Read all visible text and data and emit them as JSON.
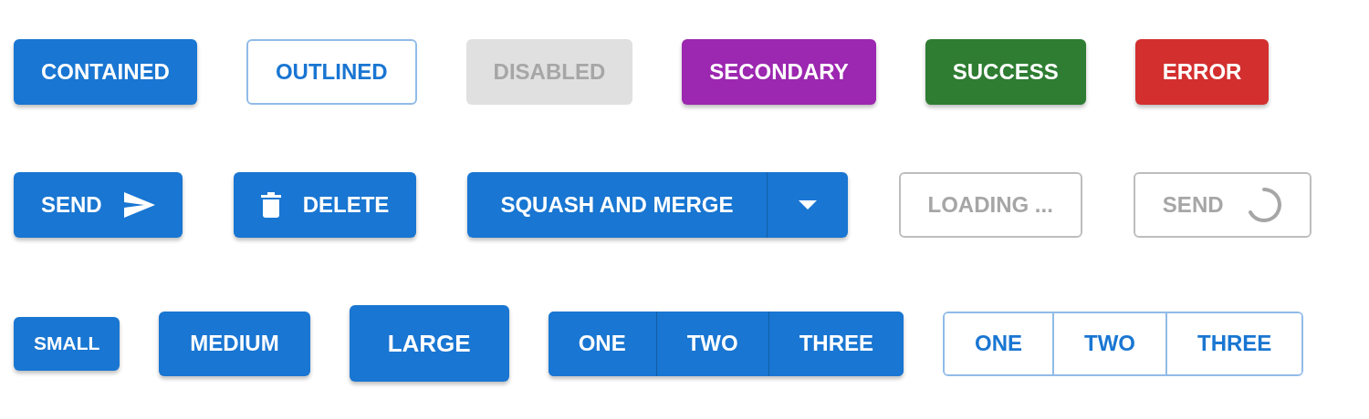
{
  "rows": [
    {
      "items": [
        {
          "kind": "contained",
          "label": "CONTAINED",
          "color": "#1976d2",
          "disabled": false
        },
        {
          "kind": "outlined",
          "label": "OUTLINED",
          "color": "#1976d2",
          "disabled": false
        },
        {
          "kind": "contained",
          "label": "DISABLED",
          "color": "#e0e0e0",
          "disabled": true
        },
        {
          "kind": "contained",
          "label": "SECONDARY",
          "color": "#9c27b0",
          "disabled": false
        },
        {
          "kind": "contained",
          "label": "SUCCESS",
          "color": "#2e7d32",
          "disabled": false
        },
        {
          "kind": "contained",
          "label": "ERROR",
          "color": "#d32f2f",
          "disabled": false
        }
      ]
    },
    {
      "items": [
        {
          "kind": "send",
          "label": "SEND",
          "disabled": false
        },
        {
          "kind": "delete",
          "label": "DELETE",
          "disabled": false
        },
        {
          "kind": "split",
          "label": "SQUASH AND MERGE",
          "disabled": false
        },
        {
          "kind": "outlined",
          "label": "LOADING ...",
          "disabled": true
        },
        {
          "kind": "spinner",
          "label": "SEND",
          "disabled": true
        }
      ]
    },
    {
      "items": [
        {
          "kind": "small",
          "label": "SMALL"
        },
        {
          "kind": "medium",
          "label": "MEDIUM"
        },
        {
          "kind": "large",
          "label": "LARGE"
        },
        {
          "kind": "group",
          "buttons": [
            {
              "label": "ONE"
            },
            {
              "label": "TWO"
            },
            {
              "label": "THREE"
            }
          ]
        },
        {
          "kind": "outlined-group",
          "buttons": [
            {
              "label": "ONE"
            },
            {
              "label": "TWO"
            },
            {
              "label": "THREE"
            }
          ]
        }
      ]
    }
  ]
}
